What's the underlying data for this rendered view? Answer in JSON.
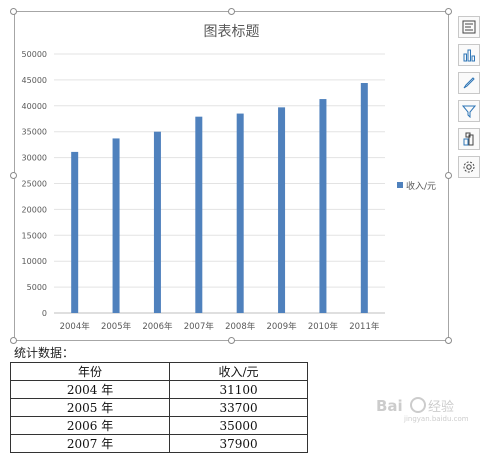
{
  "chart_data": {
    "type": "bar",
    "title": "图表标题",
    "categories": [
      "2004年",
      "2005年",
      "2006年",
      "2007年",
      "2008年",
      "2009年",
      "2010年",
      "2011年"
    ],
    "series": [
      {
        "name": "收入/元",
        "values": [
          31100,
          33700,
          35000,
          37900,
          38500,
          39700,
          41300,
          44400
        ]
      }
    ],
    "ylim": [
      0,
      50000
    ],
    "yticks": [
      "0",
      "5000",
      "10000",
      "15000",
      "20000",
      "25000",
      "30000",
      "35000",
      "40000",
      "45000",
      "50000"
    ],
    "grid": true,
    "legend": "right",
    "bar_color": "#4f81bd"
  },
  "sidebar": {
    "buttons": [
      "chart-elements-icon",
      "chart-type-icon",
      "chart-style-icon",
      "filter-icon",
      "chart-layout-icon",
      "settings-icon"
    ]
  },
  "caption": "统计数据：",
  "table": {
    "headers": [
      "年份",
      "收入/元"
    ],
    "rows": [
      [
        "2004 年",
        "31100"
      ],
      [
        "2005 年",
        "33700"
      ],
      [
        "2006 年",
        "35000"
      ],
      [
        "2007 年",
        "37900"
      ]
    ]
  },
  "watermark": {
    "text": "Bai 经验",
    "sub": "jingyan.baidu.com"
  }
}
